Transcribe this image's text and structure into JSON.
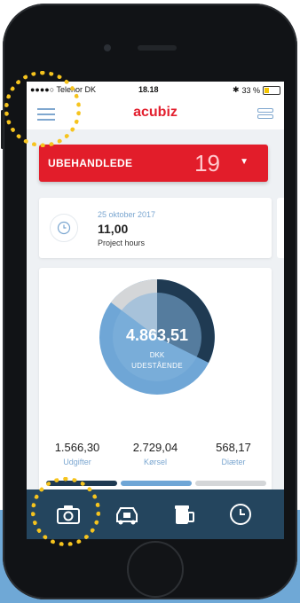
{
  "status_bar": {
    "carrier": "●●●●○ Telenor DK",
    "time": "18.18",
    "battery": "33 %"
  },
  "header": {
    "brand": "acubiz"
  },
  "unhandled": {
    "label": "UBEHANDLEDE",
    "count": "19"
  },
  "hours_card": {
    "date": "25 oktober 2017",
    "value": "11,00",
    "caption": "Project hours"
  },
  "summary": {
    "amount": "4.863,51",
    "currency": "DKK",
    "caption": "UDESTÅENDE",
    "stats": [
      {
        "value": "1.566,30",
        "label": "Udgifter"
      },
      {
        "value": "2.729,04",
        "label": "Kørsel"
      },
      {
        "value": "568,17",
        "label": "Diæter"
      }
    ]
  },
  "colors": {
    "brand_red": "#e21d2a",
    "accent_blue": "#7aa6d0",
    "tabbar": "#24455e",
    "highlight_ring": "#f6c41e"
  },
  "tabs": [
    "camera-icon",
    "car-icon",
    "coffee-icon",
    "clock-icon"
  ]
}
